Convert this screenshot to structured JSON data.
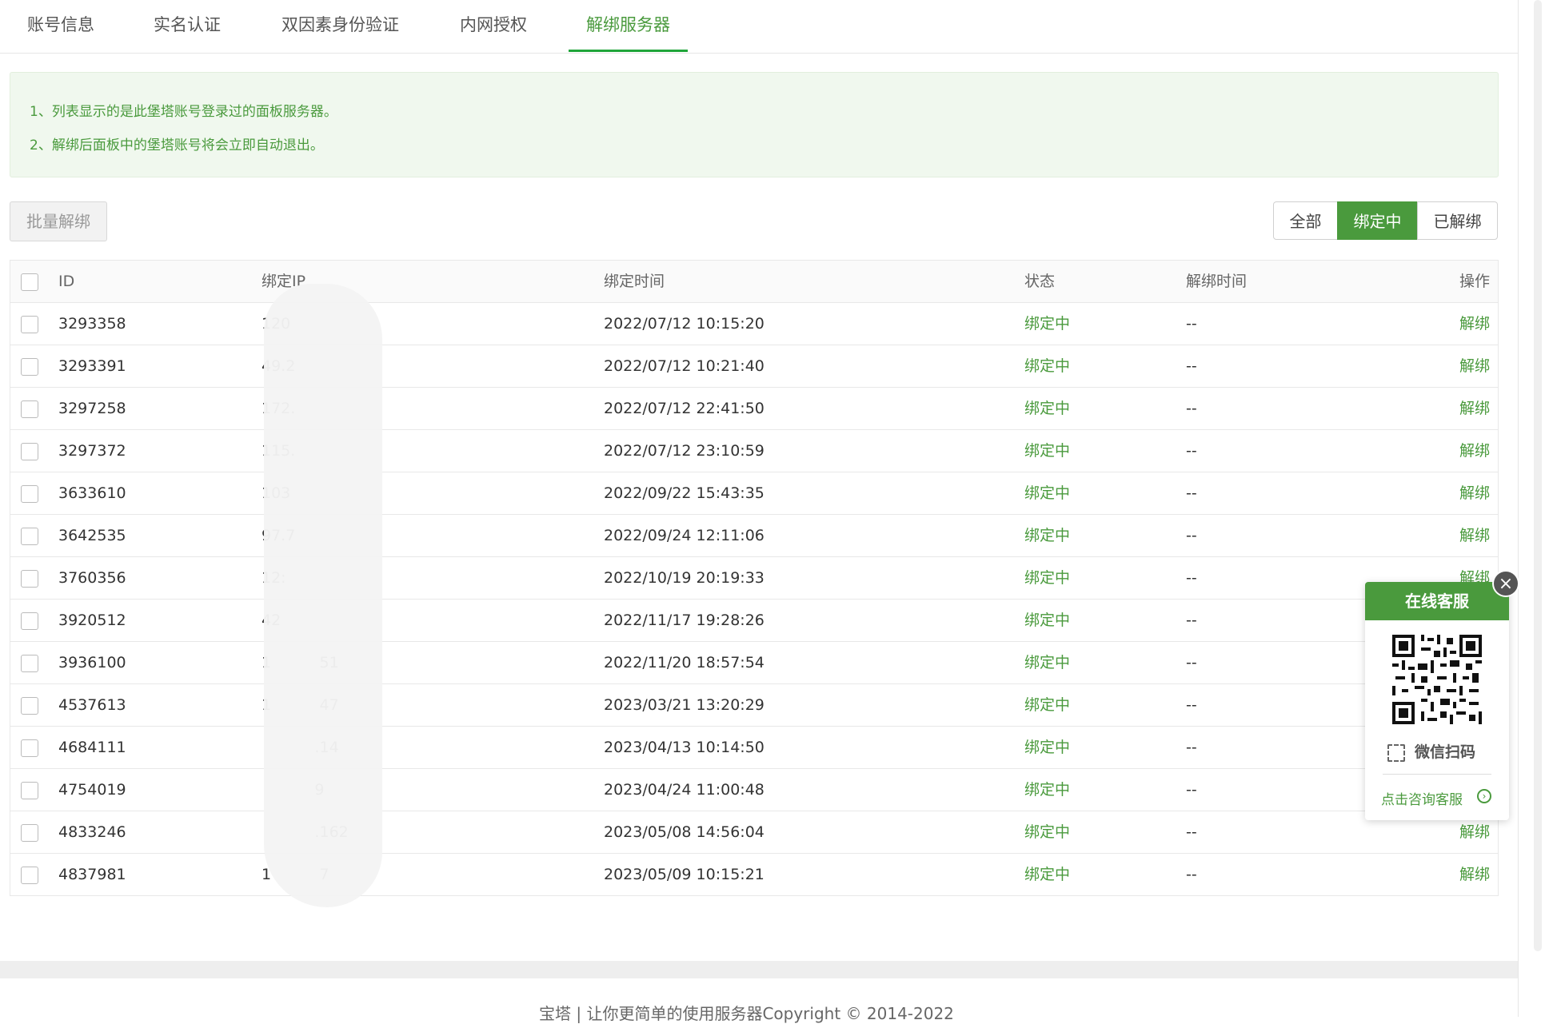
{
  "tabs": [
    {
      "label": "账号信息"
    },
    {
      "label": "实名认证"
    },
    {
      "label": "双因素身份验证"
    },
    {
      "label": "内网授权"
    },
    {
      "label": "解绑服务器"
    }
  ],
  "notice": {
    "line1": "1、列表显示的是此堡塔账号登录过的面板服务器。",
    "line2": "2、解绑后面板中的堡塔账号将会立即自动退出。"
  },
  "toolbar": {
    "batch_label": "批量解绑",
    "filters": [
      "全部",
      "绑定中",
      "已解绑"
    ],
    "active_filter": "绑定中"
  },
  "table": {
    "headers": {
      "id": "ID",
      "ip": "绑定IP",
      "time": "绑定时间",
      "status": "状态",
      "unbind_time": "解绑时间",
      "op": "操作"
    },
    "rows": [
      {
        "id": "3293358",
        "ip": "120",
        "time": "2022/07/12 10:15:20",
        "status": "绑定中",
        "unbind_time": "--",
        "op": "解绑"
      },
      {
        "id": "3293391",
        "ip": "49.2",
        "time": "2022/07/12 10:21:40",
        "status": "绑定中",
        "unbind_time": "--",
        "op": "解绑"
      },
      {
        "id": "3297258",
        "ip": "172.",
        "time": "2022/07/12 22:41:50",
        "status": "绑定中",
        "unbind_time": "--",
        "op": "解绑"
      },
      {
        "id": "3297372",
        "ip": "115.",
        "time": "2022/07/12 23:10:59",
        "status": "绑定中",
        "unbind_time": "--",
        "op": "解绑"
      },
      {
        "id": "3633610",
        "ip": "103",
        "time": "2022/09/22 15:43:35",
        "status": "绑定中",
        "unbind_time": "--",
        "op": "解绑"
      },
      {
        "id": "3642535",
        "ip": "97.7",
        "time": "2022/09/24 12:11:06",
        "status": "绑定中",
        "unbind_time": "--",
        "op": "解绑"
      },
      {
        "id": "3760356",
        "ip": "12:",
        "time": "2022/10/19 20:19:33",
        "status": "绑定中",
        "unbind_time": "--",
        "op": "解绑"
      },
      {
        "id": "3920512",
        "ip": "42",
        "time": "2022/11/17 19:28:26",
        "status": "绑定中",
        "unbind_time": "--",
        "op": "解绑"
      },
      {
        "id": "3936100",
        "ip": "1          51",
        "time": "2022/11/20 18:57:54",
        "status": "绑定中",
        "unbind_time": "--",
        "op": "解绑"
      },
      {
        "id": "4537613",
        "ip": "1          47",
        "time": "2023/03/21 13:20:29",
        "status": "绑定中",
        "unbind_time": "--",
        "op": "解绑"
      },
      {
        "id": "4684111",
        "ip": "           .14",
        "time": "2023/04/13 10:14:50",
        "status": "绑定中",
        "unbind_time": "--",
        "op": "解绑"
      },
      {
        "id": "4754019",
        "ip": "           9",
        "time": "2023/04/24 11:00:48",
        "status": "绑定中",
        "unbind_time": "--",
        "op": "解绑"
      },
      {
        "id": "4833246",
        "ip": "           .162",
        "time": "2023/05/08 14:56:04",
        "status": "绑定中",
        "unbind_time": "--",
        "op": "解绑"
      },
      {
        "id": "4837981",
        "ip": "1          7",
        "time": "2023/05/09 10:15:21",
        "status": "绑定中",
        "unbind_time": "--",
        "op": "解绑"
      }
    ]
  },
  "support": {
    "title": "在线客服",
    "scan_label": "微信扫码",
    "consult_label": "点击咨询客服",
    "close_icon": "×"
  },
  "footer": {
    "text": "宝塔 | 让你更简单的使用服务器Copyright © 2014-2022"
  },
  "colors": {
    "accent": "#4a9a3d"
  }
}
